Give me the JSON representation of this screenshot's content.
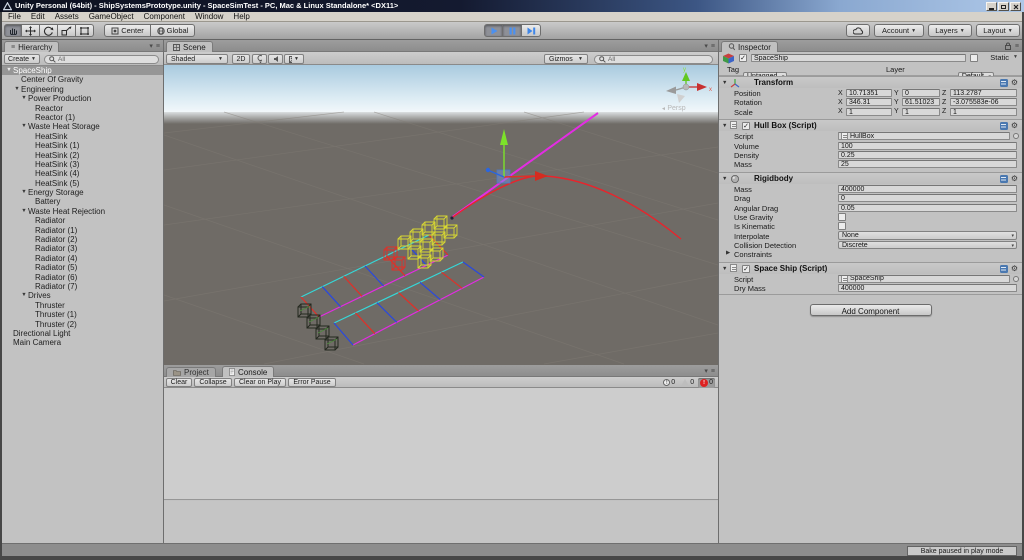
{
  "window": {
    "title": "Unity Personal (64bit) - ShipSystemsPrototype.unity - SpaceSimTest - PC, Mac & Linux Standalone* <DX11>"
  },
  "menu": {
    "items": [
      "File",
      "Edit",
      "Assets",
      "GameObject",
      "Component",
      "Window",
      "Help"
    ]
  },
  "toolbar": {
    "center": "Center",
    "global": "Global",
    "account": "Account",
    "layers": "Layers",
    "layout": "Layout"
  },
  "hierarchy": {
    "tab": "Hierarchy",
    "create": "Create",
    "search_filter": "All",
    "items": [
      {
        "label": "SpaceShip",
        "depth": 0,
        "fold": true,
        "selected": true
      },
      {
        "label": "Center Of Gravity",
        "depth": 1
      },
      {
        "label": "Engineering",
        "depth": 1,
        "fold": true
      },
      {
        "label": "Power Production",
        "depth": 2,
        "fold": true
      },
      {
        "label": "Reactor",
        "depth": 3
      },
      {
        "label": "Reactor (1)",
        "depth": 3
      },
      {
        "label": "Waste Heat Storage",
        "depth": 2,
        "fold": true
      },
      {
        "label": "HeatSink",
        "depth": 3
      },
      {
        "label": "HeatSink (1)",
        "depth": 3
      },
      {
        "label": "HeatSink (2)",
        "depth": 3
      },
      {
        "label": "HeatSink (3)",
        "depth": 3
      },
      {
        "label": "HeatSink (4)",
        "depth": 3
      },
      {
        "label": "HeatSink (5)",
        "depth": 3
      },
      {
        "label": "Energy Storage",
        "depth": 2,
        "fold": true
      },
      {
        "label": "Battery",
        "depth": 3
      },
      {
        "label": "Waste Heat Rejection",
        "depth": 2,
        "fold": true
      },
      {
        "label": "Radiator",
        "depth": 3
      },
      {
        "label": "Radiator (1)",
        "depth": 3
      },
      {
        "label": "Radiator (2)",
        "depth": 3
      },
      {
        "label": "Radiator (3)",
        "depth": 3
      },
      {
        "label": "Radiator (4)",
        "depth": 3
      },
      {
        "label": "Radiator (5)",
        "depth": 3
      },
      {
        "label": "Radiator (6)",
        "depth": 3
      },
      {
        "label": "Radiator (7)",
        "depth": 3
      },
      {
        "label": "Drives",
        "depth": 2,
        "fold": true
      },
      {
        "label": "Thruster",
        "depth": 3
      },
      {
        "label": "Thruster (1)",
        "depth": 3
      },
      {
        "label": "Thruster (2)",
        "depth": 3
      },
      {
        "label": "Directional Light",
        "depth": 0
      },
      {
        "label": "Main Camera",
        "depth": 0
      }
    ]
  },
  "scene": {
    "tab": "Scene",
    "render_mode": "Shaded",
    "mode_2d": "2D",
    "gizmos": "Gizmos",
    "search_filter": "All",
    "persp": "Persp",
    "axis_x": "x",
    "axis_y": "y"
  },
  "console": {
    "project_tab": "Project",
    "tab": "Console",
    "clear": "Clear",
    "collapse": "Collapse",
    "clear_on_play": "Clear on Play",
    "error_pause": "Error Pause",
    "info_count": "0",
    "warning_count": "0",
    "error_count": "0"
  },
  "inspector": {
    "tab": "Inspector",
    "name": "SpaceShip",
    "static_label": "Static",
    "tag_label": "Tag",
    "tag_value": "Untagged",
    "layer_label": "Layer",
    "layer_value": "Default",
    "transform": {
      "title": "Transform",
      "axis": [
        "X",
        "Y",
        "Z"
      ],
      "rows": [
        {
          "label": "Position",
          "x": "10.71351",
          "y": "0",
          "z": "113.2787"
        },
        {
          "label": "Rotation",
          "x": "346.31",
          "y": "61.51023",
          "z": "-3.075583e-06"
        },
        {
          "label": "Scale",
          "x": "1",
          "y": "1",
          "z": "1"
        }
      ]
    },
    "hullbox": {
      "title": "Hull Box (Script)",
      "script_label": "Script",
      "script_value": "HullBox",
      "fields": [
        [
          "Volume",
          "100"
        ],
        [
          "Density",
          "0.25"
        ],
        [
          "Mass",
          "25"
        ]
      ]
    },
    "rigidbody": {
      "title": "Rigidbody",
      "fields": [
        [
          "Mass",
          "400000"
        ],
        [
          "Drag",
          "0"
        ],
        [
          "Angular Drag",
          "0.05"
        ]
      ],
      "checks": [
        [
          "Use Gravity",
          false
        ],
        [
          "Is Kinematic",
          false
        ]
      ],
      "dropdowns": [
        [
          "Interpolate",
          "None"
        ],
        [
          "Collision Detection",
          "Discrete"
        ]
      ],
      "constraints": "Constraints"
    },
    "spaceship": {
      "title": "Space Ship (Script)",
      "script_label": "Script",
      "script_value": "SpaceShip",
      "fields": [
        [
          "Dry Mass",
          "400000"
        ]
      ]
    },
    "add_component": "Add Component"
  },
  "status": {
    "bake": "Bake paused in play mode"
  },
  "colors": {
    "trajectory": "#e32ce3",
    "orbit": "#e8242c",
    "rail_cyan": "#35d8d8",
    "rail_magenta": "#e22ce2",
    "rung_red": "#e03028",
    "rung_blue": "#2848e0",
    "heatsink_yellow": "#d8d832",
    "axis_green": "#7ce22a",
    "axis_blue": "#2a66e0",
    "axis_red": "#e03028",
    "play_blue": "#3f86e8",
    "sky": "#a9cadf",
    "ground": "#6f6b66",
    "selection": "#969696"
  }
}
